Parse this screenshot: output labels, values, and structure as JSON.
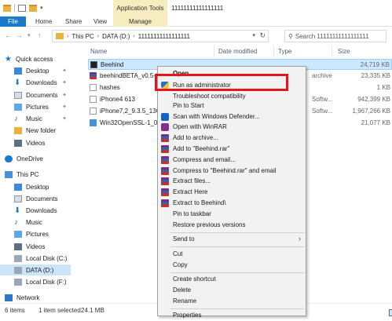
{
  "window": {
    "title": "11111111111111111",
    "app_tools_label": "Application Tools"
  },
  "ribbon": {
    "tabs": [
      "File",
      "Home",
      "Share",
      "View",
      "Manage"
    ]
  },
  "address": {
    "crumbs": [
      "This PC",
      "DATA (D:)",
      "11111111111111111"
    ],
    "search_placeholder": "Search 11111111111111111"
  },
  "nav": {
    "quick_access": "Quick access",
    "quick_items": [
      "Desktop",
      "Downloads",
      "Documents",
      "Pictures",
      "Music",
      "New folder",
      "Videos"
    ],
    "onedrive": "OneDrive",
    "this_pc": "This PC",
    "pc_items": [
      "Desktop",
      "Documents",
      "Downloads",
      "Music",
      "Pictures",
      "Videos",
      "Local Disk (C:)",
      "DATA (D:)",
      "Local Disk (F:)"
    ],
    "network": "Network"
  },
  "columns": {
    "name": "Name",
    "date_modified": "Date modified",
    "type": "Type",
    "size": "Size"
  },
  "files": [
    {
      "name": "Beehind",
      "type": "",
      "size": "24,719 KB"
    },
    {
      "name": "beehindBETA_v0.5-1f",
      "type": "archive",
      "size": "23,335 KB"
    },
    {
      "name": "hashes",
      "type": "",
      "size": "1 KB"
    },
    {
      "name": "iPhone4 613",
      "type": "Softw...",
      "size": "942,399 KB"
    },
    {
      "name": "iPhone7,2_9.3.5_13G3",
      "type": "Softw...",
      "size": "1,967,266 KB"
    },
    {
      "name": "Win32OpenSSL-1_0_2",
      "type": "",
      "size": "21,077 KB"
    }
  ],
  "status": {
    "items": "6 items",
    "selected": "1 item selected",
    "size": "24.1 MB"
  },
  "context_menu": {
    "open": "Open",
    "run_as_admin": "Run as administrator",
    "troubleshoot": "Troubleshoot compatibility",
    "pin_start": "Pin to Start",
    "scan_defender": "Scan with Windows Defender...",
    "open_winrar": "Open with WinRAR",
    "add_archive": "Add to archive...",
    "add_rar": "Add to \"Beehind.rar\"",
    "compress_email": "Compress and email...",
    "compress_rar_email": "Compress to \"Beehind.rar\" and email",
    "extract_files": "Extract files...",
    "extract_here": "Extract Here",
    "extract_to": "Extract to Beehind\\",
    "pin_taskbar": "Pin to taskbar",
    "restore": "Restore previous versions",
    "send_to": "Send to",
    "cut": "Cut",
    "copy": "Copy",
    "create_shortcut": "Create shortcut",
    "delete": "Delete",
    "rename": "Rename",
    "properties": "Properties"
  },
  "colors": {
    "file_tab": "#1979ca",
    "app_tools": "#f6ecbf",
    "selection": "#cce8ff",
    "highlight_box": "#e4161c"
  }
}
